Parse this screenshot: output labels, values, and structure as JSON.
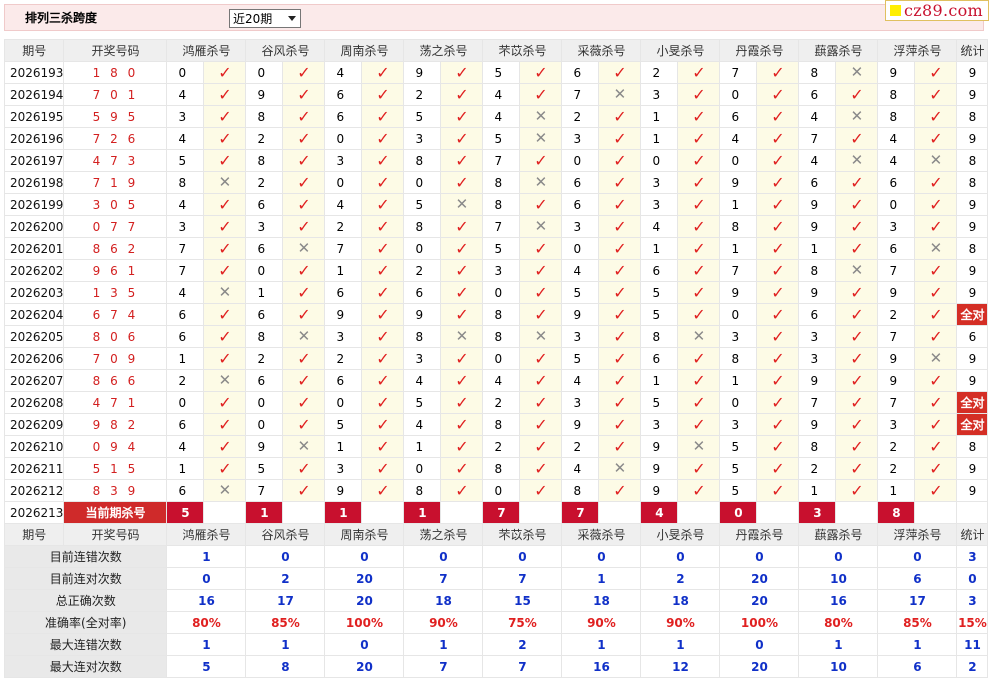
{
  "topbar": {
    "title": "排列三杀跨度",
    "period_select": "近20期"
  },
  "logo": {
    "text": "cz89.com"
  },
  "headers": [
    "期号",
    "开奖号码",
    "鸿雁杀号",
    "谷风杀号",
    "周南杀号",
    "荡之杀号",
    "芣苡杀号",
    "采薇杀号",
    "小旻杀号",
    "丹霞杀号",
    "蕻露杀号",
    "浮萍杀号",
    "统计"
  ],
  "rows": [
    {
      "period": "2026193",
      "number": "1 8 0",
      "kills": [
        "0",
        "0",
        "4",
        "9",
        "5",
        "6",
        "2",
        "7",
        "8",
        "9"
      ],
      "ok": [
        1,
        1,
        1,
        1,
        1,
        1,
        1,
        1,
        0,
        1
      ],
      "total": "9"
    },
    {
      "period": "2026194",
      "number": "7 0 1",
      "kills": [
        "4",
        "9",
        "6",
        "2",
        "4",
        "7",
        "3",
        "0",
        "6",
        "8"
      ],
      "ok": [
        1,
        1,
        1,
        1,
        1,
        0,
        1,
        1,
        1,
        1
      ],
      "total": "9"
    },
    {
      "period": "2026195",
      "number": "5 9 5",
      "kills": [
        "3",
        "8",
        "6",
        "5",
        "4",
        "2",
        "1",
        "6",
        "4",
        "8"
      ],
      "ok": [
        1,
        1,
        1,
        1,
        0,
        1,
        1,
        1,
        0,
        1
      ],
      "total": "8"
    },
    {
      "period": "2026196",
      "number": "7 2 6",
      "kills": [
        "4",
        "2",
        "0",
        "3",
        "5",
        "3",
        "1",
        "4",
        "7",
        "4"
      ],
      "ok": [
        1,
        1,
        1,
        1,
        0,
        1,
        1,
        1,
        1,
        1
      ],
      "total": "9"
    },
    {
      "period": "2026197",
      "number": "4 7 3",
      "kills": [
        "5",
        "8",
        "3",
        "8",
        "7",
        "0",
        "0",
        "0",
        "4",
        "4"
      ],
      "ok": [
        1,
        1,
        1,
        1,
        1,
        1,
        1,
        1,
        0,
        0
      ],
      "total": "8"
    },
    {
      "period": "2026198",
      "number": "7 1 9",
      "kills": [
        "8",
        "2",
        "0",
        "0",
        "8",
        "6",
        "3",
        "9",
        "6",
        "6"
      ],
      "ok": [
        0,
        1,
        1,
        1,
        0,
        1,
        1,
        1,
        1,
        1
      ],
      "total": "8"
    },
    {
      "period": "2026199",
      "number": "3 0 5",
      "kills": [
        "4",
        "6",
        "4",
        "5",
        "8",
        "6",
        "3",
        "1",
        "9",
        "0"
      ],
      "ok": [
        1,
        1,
        1,
        0,
        1,
        1,
        1,
        1,
        1,
        1
      ],
      "total": "9"
    },
    {
      "period": "2026200",
      "number": "0 7 7",
      "kills": [
        "3",
        "3",
        "2",
        "8",
        "7",
        "3",
        "4",
        "8",
        "9",
        "3"
      ],
      "ok": [
        1,
        1,
        1,
        1,
        0,
        1,
        1,
        1,
        1,
        1
      ],
      "total": "9"
    },
    {
      "period": "2026201",
      "number": "8 6 2",
      "kills": [
        "7",
        "6",
        "7",
        "0",
        "5",
        "0",
        "1",
        "1",
        "1",
        "6"
      ],
      "ok": [
        1,
        0,
        1,
        1,
        1,
        1,
        1,
        1,
        1,
        0
      ],
      "total": "8"
    },
    {
      "period": "2026202",
      "number": "9 6 1",
      "kills": [
        "7",
        "0",
        "1",
        "2",
        "3",
        "4",
        "6",
        "7",
        "8",
        "7"
      ],
      "ok": [
        1,
        1,
        1,
        1,
        1,
        1,
        1,
        1,
        0,
        1
      ],
      "total": "9"
    },
    {
      "period": "2026203",
      "number": "1 3 5",
      "kills": [
        "4",
        "1",
        "6",
        "6",
        "0",
        "5",
        "5",
        "9",
        "9",
        "9"
      ],
      "ok": [
        0,
        1,
        1,
        1,
        1,
        1,
        1,
        1,
        1,
        1
      ],
      "total": "9"
    },
    {
      "period": "2026204",
      "number": "6 7 4",
      "kills": [
        "6",
        "6",
        "9",
        "9",
        "8",
        "9",
        "5",
        "0",
        "6",
        "2"
      ],
      "ok": [
        1,
        1,
        1,
        1,
        1,
        1,
        1,
        1,
        1,
        1
      ],
      "total": "全对"
    },
    {
      "period": "2026205",
      "number": "8 0 6",
      "kills": [
        "6",
        "8",
        "3",
        "8",
        "8",
        "3",
        "8",
        "3",
        "3",
        "7"
      ],
      "ok": [
        1,
        0,
        1,
        0,
        0,
        1,
        0,
        1,
        1,
        1
      ],
      "total": "6"
    },
    {
      "period": "2026206",
      "number": "7 0 9",
      "kills": [
        "1",
        "2",
        "2",
        "3",
        "0",
        "5",
        "6",
        "8",
        "3",
        "9"
      ],
      "ok": [
        1,
        1,
        1,
        1,
        1,
        1,
        1,
        1,
        1,
        0
      ],
      "total": "9"
    },
    {
      "period": "2026207",
      "number": "8 6 6",
      "kills": [
        "2",
        "6",
        "6",
        "4",
        "4",
        "4",
        "1",
        "1",
        "9",
        "9"
      ],
      "ok": [
        0,
        1,
        1,
        1,
        1,
        1,
        1,
        1,
        1,
        1
      ],
      "total": "9"
    },
    {
      "period": "2026208",
      "number": "4 7 1",
      "kills": [
        "0",
        "0",
        "0",
        "5",
        "2",
        "3",
        "5",
        "0",
        "7",
        "7"
      ],
      "ok": [
        1,
        1,
        1,
        1,
        1,
        1,
        1,
        1,
        1,
        1
      ],
      "total": "全对"
    },
    {
      "period": "2026209",
      "number": "9 8 2",
      "kills": [
        "6",
        "0",
        "5",
        "4",
        "8",
        "9",
        "3",
        "3",
        "9",
        "3"
      ],
      "ok": [
        1,
        1,
        1,
        1,
        1,
        1,
        1,
        1,
        1,
        1
      ],
      "total": "全对"
    },
    {
      "period": "2026210",
      "number": "0 9 4",
      "kills": [
        "4",
        "9",
        "1",
        "1",
        "2",
        "2",
        "9",
        "5",
        "8",
        "2"
      ],
      "ok": [
        1,
        0,
        1,
        1,
        1,
        1,
        0,
        1,
        1,
        1
      ],
      "total": "8"
    },
    {
      "period": "2026211",
      "number": "5 1 5",
      "kills": [
        "1",
        "5",
        "3",
        "0",
        "8",
        "4",
        "9",
        "5",
        "2",
        "2"
      ],
      "ok": [
        1,
        1,
        1,
        1,
        1,
        0,
        1,
        1,
        1,
        1
      ],
      "total": "9"
    },
    {
      "period": "2026212",
      "number": "8 3 9",
      "kills": [
        "6",
        "7",
        "9",
        "8",
        "0",
        "8",
        "9",
        "5",
        "1",
        "1"
      ],
      "ok": [
        0,
        1,
        1,
        1,
        1,
        1,
        1,
        1,
        1,
        1
      ],
      "total": "9"
    }
  ],
  "current": {
    "period": "2026213",
    "label": "当前期杀号",
    "kills": [
      "5",
      "1",
      "1",
      "1",
      "7",
      "7",
      "4",
      "0",
      "3",
      "8"
    ]
  },
  "stats": [
    {
      "label": "目前连错次数",
      "values": [
        "1",
        "0",
        "0",
        "0",
        "0",
        "0",
        "0",
        "0",
        "0",
        "0",
        "3"
      ]
    },
    {
      "label": "目前连对次数",
      "values": [
        "0",
        "2",
        "20",
        "7",
        "7",
        "1",
        "2",
        "20",
        "10",
        "6",
        "0"
      ]
    },
    {
      "label": "总正确次数",
      "values": [
        "16",
        "17",
        "20",
        "18",
        "15",
        "18",
        "18",
        "20",
        "16",
        "17",
        "3"
      ]
    },
    {
      "label": "准确率(全对率)",
      "values": [
        "80%",
        "85%",
        "100%",
        "90%",
        "75%",
        "90%",
        "90%",
        "100%",
        "80%",
        "85%",
        "15%"
      ],
      "red": true
    },
    {
      "label": "最大连错次数",
      "values": [
        "1",
        "1",
        "0",
        "1",
        "2",
        "1",
        "1",
        "0",
        "1",
        "1",
        "11"
      ]
    },
    {
      "label": "最大连对次数",
      "values": [
        "5",
        "8",
        "20",
        "7",
        "7",
        "16",
        "12",
        "20",
        "10",
        "6",
        "2"
      ]
    }
  ],
  "symbols": {
    "check": "✓",
    "cross": "✕"
  }
}
